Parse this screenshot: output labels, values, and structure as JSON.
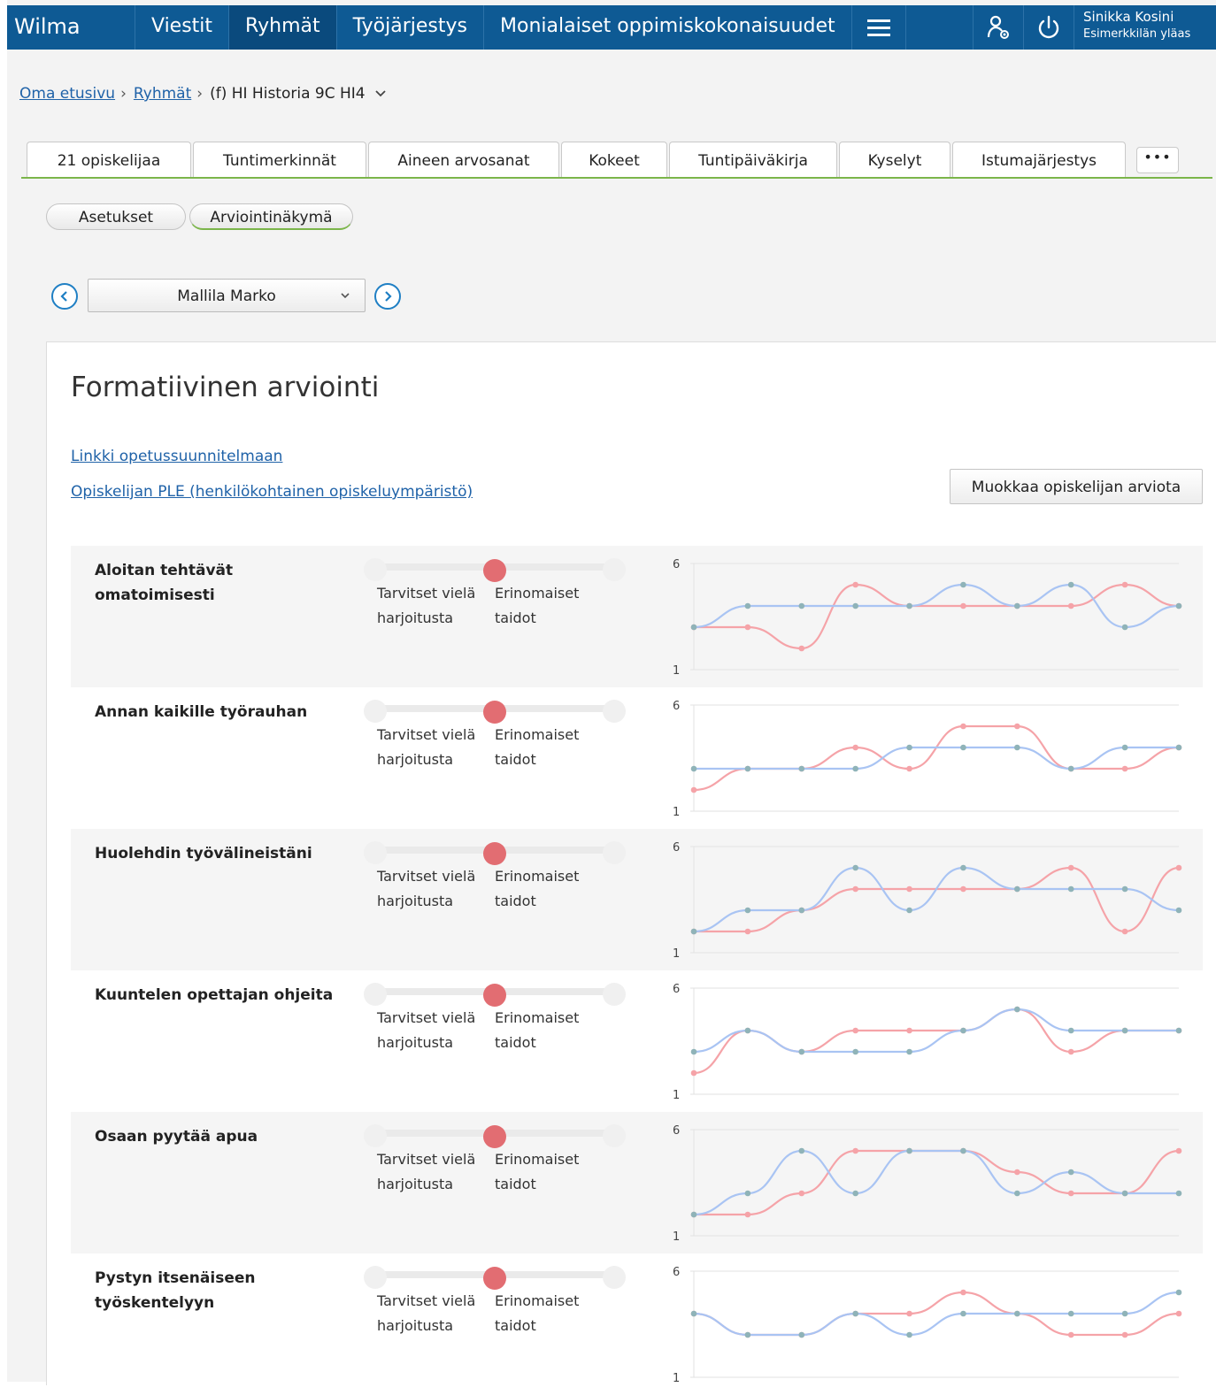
{
  "topbar": {
    "brand": "Wilma",
    "nav": [
      "Viestit",
      "Ryhmät",
      "Työjärjestys",
      "Monialaiset oppimiskokonaisuudet"
    ],
    "active_nav": "Ryhmät",
    "user_name": "Sinikka Kosini",
    "user_school": "Esimerkkilän yläas"
  },
  "breadcrumb": {
    "home": "Oma etusivu",
    "groups": "Ryhmät",
    "current": "(f) HI Historia 9C HI4"
  },
  "tabs": [
    "21 opiskelijaa",
    "Tuntimerkinnät",
    "Aineen arvosanat",
    "Kokeet",
    "Tuntipäiväkirja",
    "Kyselyt",
    "Istumajärjestys"
  ],
  "tabs_more": "•••",
  "subtabs": {
    "settings": "Asetukset",
    "assessment_view": "Arviointinäkymä"
  },
  "student": {
    "selected": "Mallila Marko"
  },
  "content": {
    "title": "Formatiivinen arviointi",
    "link_curriculum": "Linkki opetussuunnitelmaan",
    "link_ple": "Opiskelijan PLE (henkilökohtainen opiskeluympäristö)",
    "edit_button": "Muokkaa opiskelijan arviota"
  },
  "scale": {
    "low_line1": "Tarvitset vielä",
    "low_line2": "harjoitusta",
    "high_line1": "Erinomaiset",
    "high_line2": "taidot",
    "slider_positions": 3,
    "slider_value": 2
  },
  "colors": {
    "series_a": "#f5a3a8",
    "series_b": "#a9c4f3",
    "point": "#8fb3b8",
    "thumb": "#e26d72",
    "nav_bg": "#0e5a94",
    "accent_green": "#7bb54a"
  },
  "chart_data": [
    {
      "type": "line",
      "title": "Aloitan tehtävät omatoimisesti",
      "y_ticks": [
        "6",
        "1"
      ],
      "ylim": [
        1,
        6
      ],
      "x": [
        1,
        2,
        3,
        4,
        5,
        6,
        7,
        8,
        9,
        10
      ],
      "series": [
        {
          "values": [
            3,
            3,
            2,
            5,
            4,
            4,
            4,
            4,
            5,
            4
          ]
        },
        {
          "values": [
            3,
            4,
            4,
            4,
            4,
            5,
            4,
            5,
            3,
            4
          ]
        }
      ]
    },
    {
      "type": "line",
      "title": "Annan kaikille työrauhan",
      "y_ticks": [
        "6",
        "1"
      ],
      "ylim": [
        1,
        6
      ],
      "x": [
        1,
        2,
        3,
        4,
        5,
        6,
        7,
        8,
        9,
        10
      ],
      "series": [
        {
          "values": [
            2,
            3,
            3,
            4,
            3,
            5,
            5,
            3,
            3,
            4
          ]
        },
        {
          "values": [
            3,
            3,
            3,
            3,
            4,
            4,
            4,
            3,
            4,
            4
          ]
        }
      ]
    },
    {
      "type": "line",
      "title": "Huolehdin työvälineistäni",
      "y_ticks": [
        "6",
        "1"
      ],
      "ylim": [
        1,
        6
      ],
      "x": [
        1,
        2,
        3,
        4,
        5,
        6,
        7,
        8,
        9,
        10
      ],
      "series": [
        {
          "values": [
            2,
            2,
            3,
            4,
            4,
            4,
            4,
            5,
            2,
            5
          ]
        },
        {
          "values": [
            2,
            3,
            3,
            5,
            3,
            5,
            4,
            4,
            4,
            3
          ]
        }
      ]
    },
    {
      "type": "line",
      "title": "Kuuntelen opettajan ohjeita",
      "y_ticks": [
        "6",
        "1"
      ],
      "ylim": [
        1,
        6
      ],
      "x": [
        1,
        2,
        3,
        4,
        5,
        6,
        7,
        8,
        9,
        10
      ],
      "series": [
        {
          "values": [
            2,
            4,
            3,
            4,
            4,
            4,
            5,
            3,
            4,
            4
          ]
        },
        {
          "values": [
            3,
            4,
            3,
            3,
            3,
            4,
            5,
            4,
            4,
            4
          ]
        }
      ]
    },
    {
      "type": "line",
      "title": "Osaan pyytää apua",
      "y_ticks": [
        "6",
        "1"
      ],
      "ylim": [
        1,
        6
      ],
      "x": [
        1,
        2,
        3,
        4,
        5,
        6,
        7,
        8,
        9,
        10
      ],
      "series": [
        {
          "values": [
            2,
            2,
            3,
            5,
            5,
            5,
            4,
            3,
            3,
            5
          ]
        },
        {
          "values": [
            2,
            3,
            5,
            3,
            5,
            5,
            3,
            4,
            3,
            3
          ]
        }
      ]
    },
    {
      "type": "line",
      "title": "Pystyn itsenäiseen työskentelyyn",
      "y_ticks": [
        "6",
        "1"
      ],
      "ylim": [
        1,
        6
      ],
      "x": [
        1,
        2,
        3,
        4,
        5,
        6,
        7,
        8,
        9,
        10
      ],
      "series": [
        {
          "values": [
            4,
            3,
            3,
            4,
            4,
            5,
            4,
            3,
            3,
            4
          ]
        },
        {
          "values": [
            4,
            3,
            3,
            4,
            3,
            4,
            4,
            4,
            4,
            5
          ]
        }
      ]
    }
  ]
}
